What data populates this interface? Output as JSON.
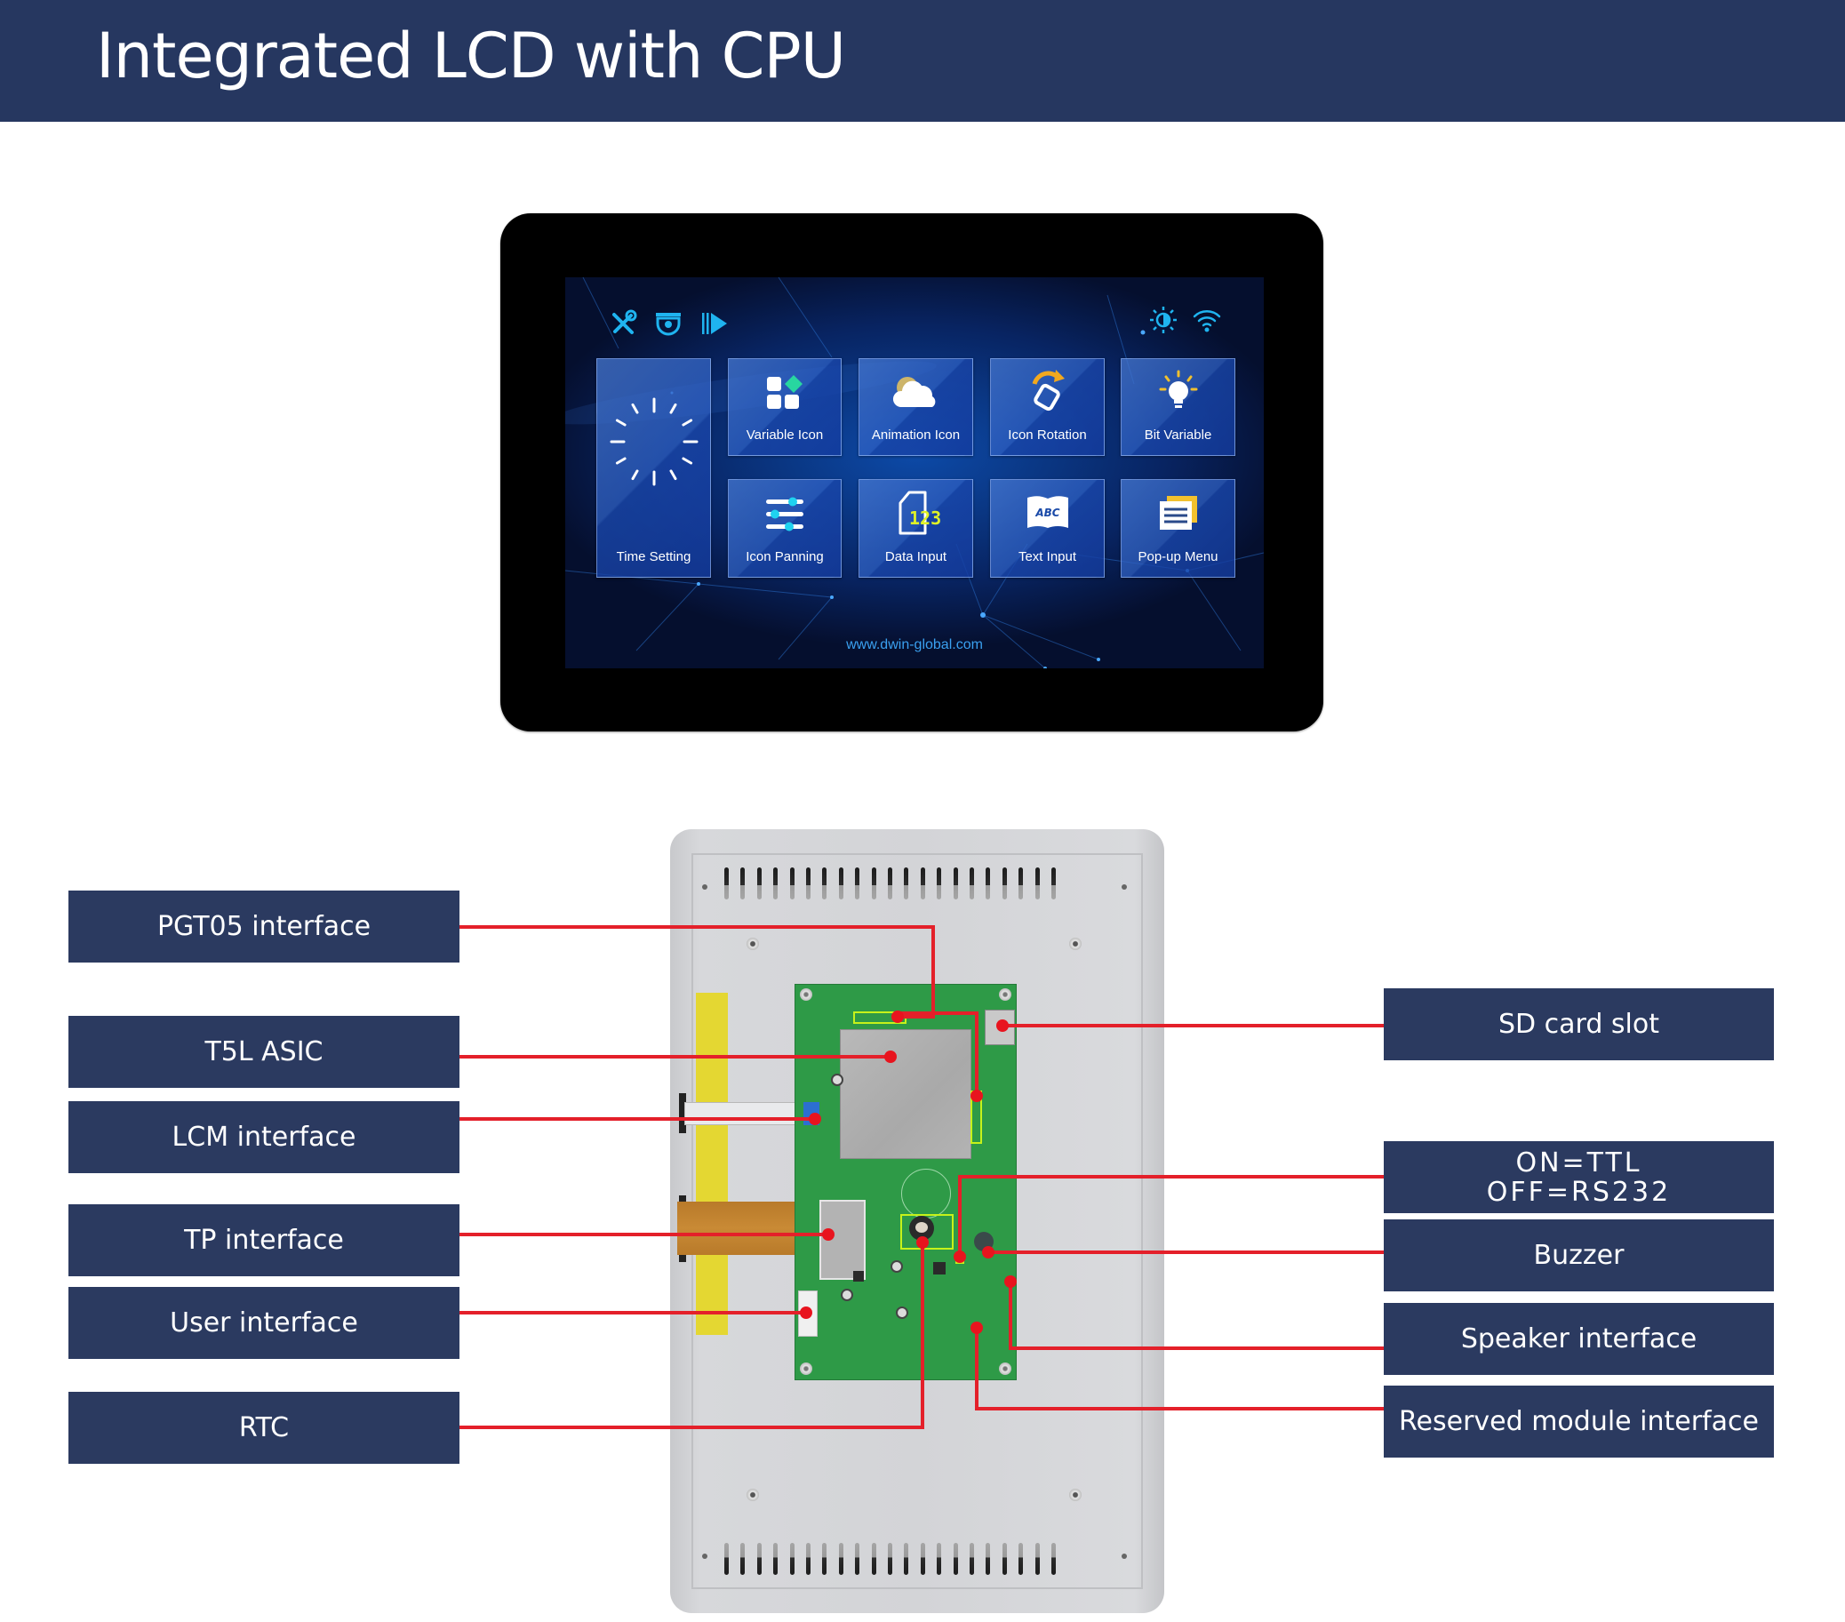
{
  "header": {
    "title": "Integrated LCD with CPU"
  },
  "lcd_front": {
    "status_icons_left": [
      "tools-icon",
      "camera-icon",
      "play-icon"
    ],
    "status_icons_right": [
      "brightness-icon",
      "wifi-icon"
    ],
    "tiles": [
      {
        "label": "Time Setting",
        "icon": "clock-icon"
      },
      {
        "label": "Variable Icon",
        "icon": "variable-grid-icon"
      },
      {
        "label": "Animation Icon",
        "icon": "cloud-icon"
      },
      {
        "label": "Icon Rotation",
        "icon": "rotate-icon"
      },
      {
        "label": "Bit Variable",
        "icon": "lightbulb-icon"
      },
      {
        "label": "Icon Panning",
        "icon": "sliders-icon"
      },
      {
        "label": "Data Input",
        "icon": "number-file-icon"
      },
      {
        "label": "Text Input",
        "icon": "abc-book-icon"
      },
      {
        "label": "Pop-up Menu",
        "icon": "menu-stack-icon"
      }
    ],
    "data_input_glyph": "123",
    "text_input_glyph": "ABC",
    "url": "www.dwin-global.com",
    "colors": {
      "icon_cyan": "#1fb4f0",
      "accent_yellow": "#f2c12e",
      "accent_green": "#28d6a0",
      "number_yellow": "#dff227"
    }
  },
  "callouts": {
    "left": [
      {
        "label": "PGT05 interface"
      },
      {
        "label": "T5L ASIC"
      },
      {
        "label": "LCM interface"
      },
      {
        "label": "TP interface"
      },
      {
        "label": "User interface"
      },
      {
        "label": "RTC"
      }
    ],
    "right": [
      {
        "label": "SD card slot"
      },
      {
        "label_line1": "ON=TTL",
        "label_line2": "OFF=RS232"
      },
      {
        "label": "Buzzer"
      },
      {
        "label": "Speaker interface"
      },
      {
        "label": "Reserved module interface"
      }
    ],
    "colors": {
      "box": "#2b3a60",
      "line": "#e4202a",
      "highlight": "#c6f21a"
    }
  }
}
